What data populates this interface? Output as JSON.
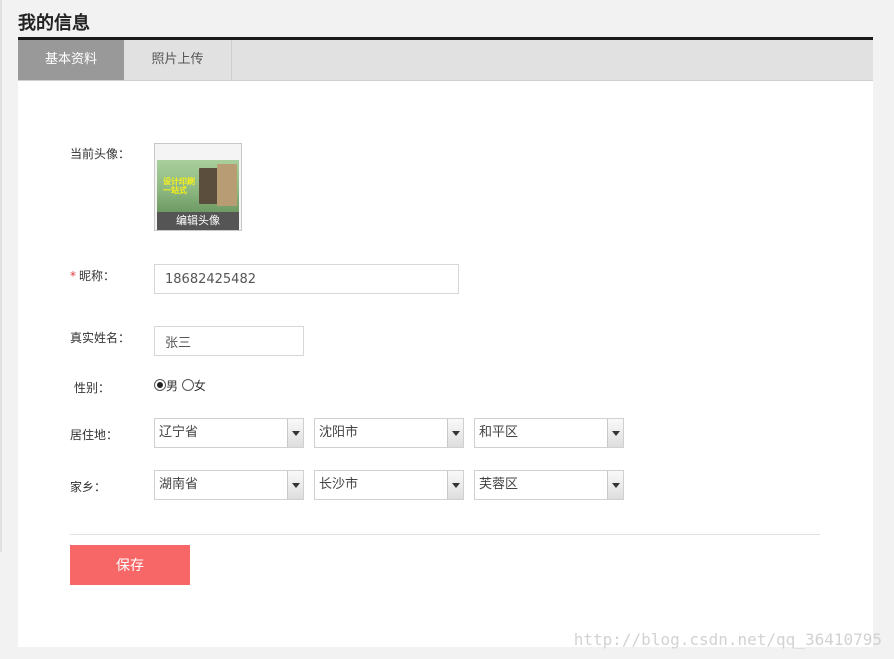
{
  "page_title": "我的信息",
  "tabs": [
    {
      "label": "基本资料",
      "active": true
    },
    {
      "label": "照片上传",
      "active": false
    }
  ],
  "form": {
    "avatar": {
      "label": "当前头像：",
      "image_text_line1": "设计印刷",
      "image_text_line2": "一站式",
      "edit_label": "编辑头像"
    },
    "nickname": {
      "required_mark": "*",
      "label": "昵称：",
      "value": "18682425482"
    },
    "real_name": {
      "label": "真实姓名：",
      "value": "张三"
    },
    "gender": {
      "label": "性别：",
      "options": [
        {
          "label": "男",
          "checked": true
        },
        {
          "label": "女",
          "checked": false
        }
      ]
    },
    "residence": {
      "label": "居住地：",
      "province": "辽宁省",
      "city": "沈阳市",
      "district": "和平区"
    },
    "hometown": {
      "label": "家乡：",
      "province": "湖南省",
      "city": "长沙市",
      "district": "芙蓉区"
    },
    "save_label": "保存"
  },
  "watermark": "http://blog.csdn.net/qq_36410795",
  "colors": {
    "active_tab": "#999999",
    "save_button": "#f76767",
    "required": "#e4393c"
  }
}
